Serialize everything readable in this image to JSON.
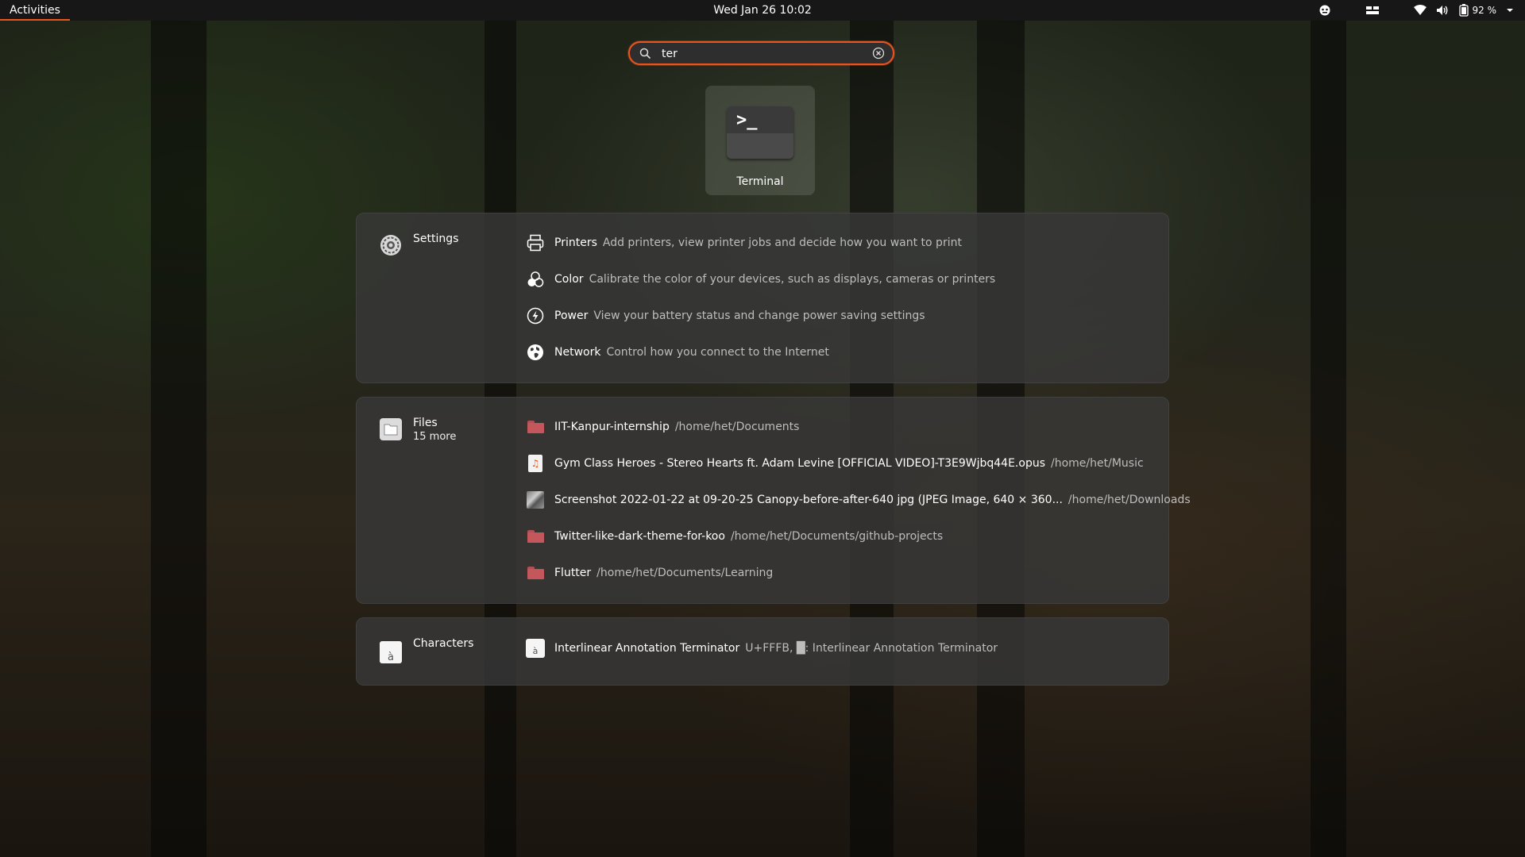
{
  "topbar": {
    "activities": "Activities",
    "clock": "Wed Jan 26  10:02",
    "battery": "92 %"
  },
  "search": {
    "query": "ter"
  },
  "app_results": [
    {
      "name": "Terminal",
      "icon": "terminal-icon"
    }
  ],
  "providers": {
    "settings": {
      "name": "Settings",
      "icon": "gear-icon",
      "results": [
        {
          "title": "Printers",
          "desc": "Add printers, view printer jobs and decide how you want to print",
          "icon": "printer-icon"
        },
        {
          "title": "Color",
          "desc": "Calibrate the color of your devices, such as displays, cameras or printers",
          "icon": "color-icon"
        },
        {
          "title": "Power",
          "desc": "View your battery status and change power saving settings",
          "icon": "power-icon"
        },
        {
          "title": "Network",
          "desc": "Control how you connect to the Internet",
          "icon": "globe-icon"
        }
      ]
    },
    "files": {
      "name": "Files",
      "more": "15 more",
      "icon": "files-icon",
      "results": [
        {
          "title": "IIT-Kanpur-internship",
          "desc": "/home/het/Documents",
          "icon": "folder-icon"
        },
        {
          "title": "Gym Class Heroes - Stereo Hearts ft. Adam Levine [OFFICIAL VIDEO]-T3E9Wjbq44E.opus",
          "desc": "/home/het/Music",
          "icon": "audio-file-icon"
        },
        {
          "title": "Screenshot 2022-01-22 at 09-20-25 Canopy-before-after-640 jpg (JPEG Image, 640 × 360...",
          "desc": "/home/het/Downloads",
          "icon": "image-thumbnail-icon"
        },
        {
          "title": "Twitter-like-dark-theme-for-koo",
          "desc": "/home/het/Documents/github-projects",
          "icon": "folder-icon"
        },
        {
          "title": "Flutter",
          "desc": "/home/het/Documents/Learning",
          "icon": "folder-icon"
        }
      ]
    },
    "characters": {
      "name": "Characters",
      "icon": "characters-icon",
      "results": [
        {
          "title": "Interlinear Annotation Terminator",
          "desc": "U+FFFB, █: Interlinear Annotation Terminator",
          "icon": "character-icon"
        }
      ]
    }
  },
  "colors": {
    "accent": "#e95420",
    "topbar": "#171717",
    "panel": "#383838"
  }
}
